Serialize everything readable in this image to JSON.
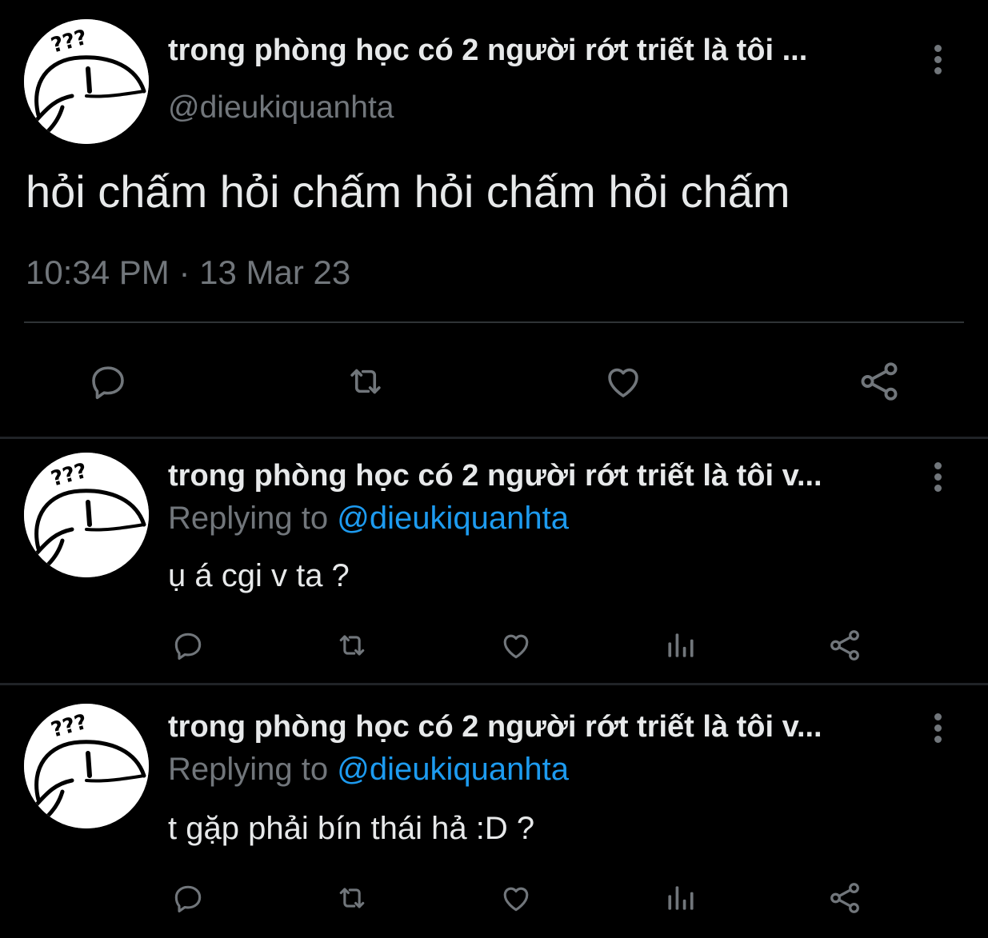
{
  "main_tweet": {
    "display_name": "trong phòng học có 2 người rớt triết là tôi ...",
    "handle": "@dieukiquanhta",
    "text": "hỏi chấm hỏi chấm hỏi chấm hỏi chấm",
    "timestamp": "10:34 PM · 13 Mar 23",
    "actions": [
      "comment-icon",
      "retweet-icon",
      "like-icon",
      "share-icon"
    ]
  },
  "replies": [
    {
      "display_name": "trong phòng học có 2 người rớt triết là tôi v...",
      "replying_prefix": "Replying to",
      "replying_handle": "@dieukiquanhta",
      "text": "ụ á cgi v ta ?",
      "actions": [
        "comment-icon",
        "retweet-icon",
        "like-icon",
        "views-icon",
        "share-icon"
      ]
    },
    {
      "display_name": "trong phòng học có 2 người rớt triết là tôi v...",
      "replying_prefix": "Replying to",
      "replying_handle": "@dieukiquanhta",
      "text": "t gặp phải bín thái hả :D ?",
      "actions": [
        "comment-icon",
        "retweet-icon",
        "like-icon",
        "views-icon",
        "share-icon"
      ]
    }
  ],
  "avatar_text": "???",
  "colors": {
    "background": "#000000",
    "text_primary": "#e7e9ea",
    "text_secondary": "#71767b",
    "link": "#1d9bf0",
    "divider": "#2f3336"
  }
}
